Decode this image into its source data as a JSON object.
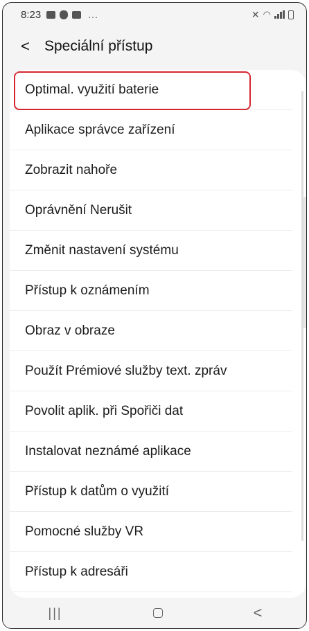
{
  "status": {
    "time": "8:23",
    "more": "..."
  },
  "header": {
    "back_glyph": "<",
    "title": "Speciální přístup"
  },
  "items": [
    {
      "label": "Optimal. využití baterie"
    },
    {
      "label": "Aplikace správce zařízení"
    },
    {
      "label": "Zobrazit nahoře"
    },
    {
      "label": "Oprávnění Nerušit"
    },
    {
      "label": "Změnit nastavení systému"
    },
    {
      "label": "Přístup k oznámením"
    },
    {
      "label": "Obraz v obraze"
    },
    {
      "label": "Použít Prémiové služby text. zpráv"
    },
    {
      "label": "Povolit aplik. při Spořiči dat"
    },
    {
      "label": "Instalovat neznámé aplikace"
    },
    {
      "label": "Přístup k datům o využití"
    },
    {
      "label": "Pomocné služby VR"
    },
    {
      "label": "Přístup k adresáři"
    }
  ],
  "highlight_color": "#d6262e",
  "nav": {
    "recent_glyph": "|||",
    "back_glyph": "<"
  }
}
